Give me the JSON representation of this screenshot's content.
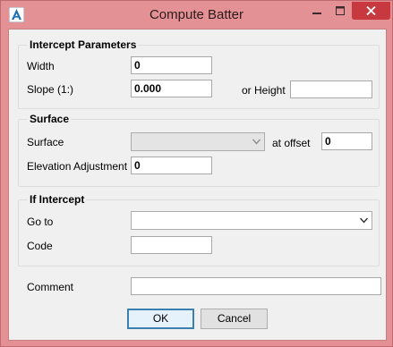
{
  "window": {
    "title": "Compute Batter"
  },
  "intercept": {
    "title": "Intercept Parameters",
    "width_label": "Width",
    "width_value": "0",
    "slope_label": "Slope (1:)",
    "slope_value": "0.000",
    "height_label": "or Height",
    "height_value": ""
  },
  "surface": {
    "title": "Surface",
    "surface_label": "Surface",
    "surface_value": "",
    "offset_label": "at offset",
    "offset_value": "0",
    "elev_label": "Elevation Adjustment",
    "elev_value": "0"
  },
  "if_intercept": {
    "title": "If Intercept",
    "goto_label": "Go to",
    "goto_value": "",
    "code_label": "Code",
    "code_value": ""
  },
  "comment": {
    "label": "Comment",
    "value": ""
  },
  "buttons": {
    "ok": "OK",
    "cancel": "Cancel"
  },
  "colors": {
    "titlebar": "#e49195",
    "close": "#c7383f",
    "dialog_bg": "#f0f0f0"
  }
}
